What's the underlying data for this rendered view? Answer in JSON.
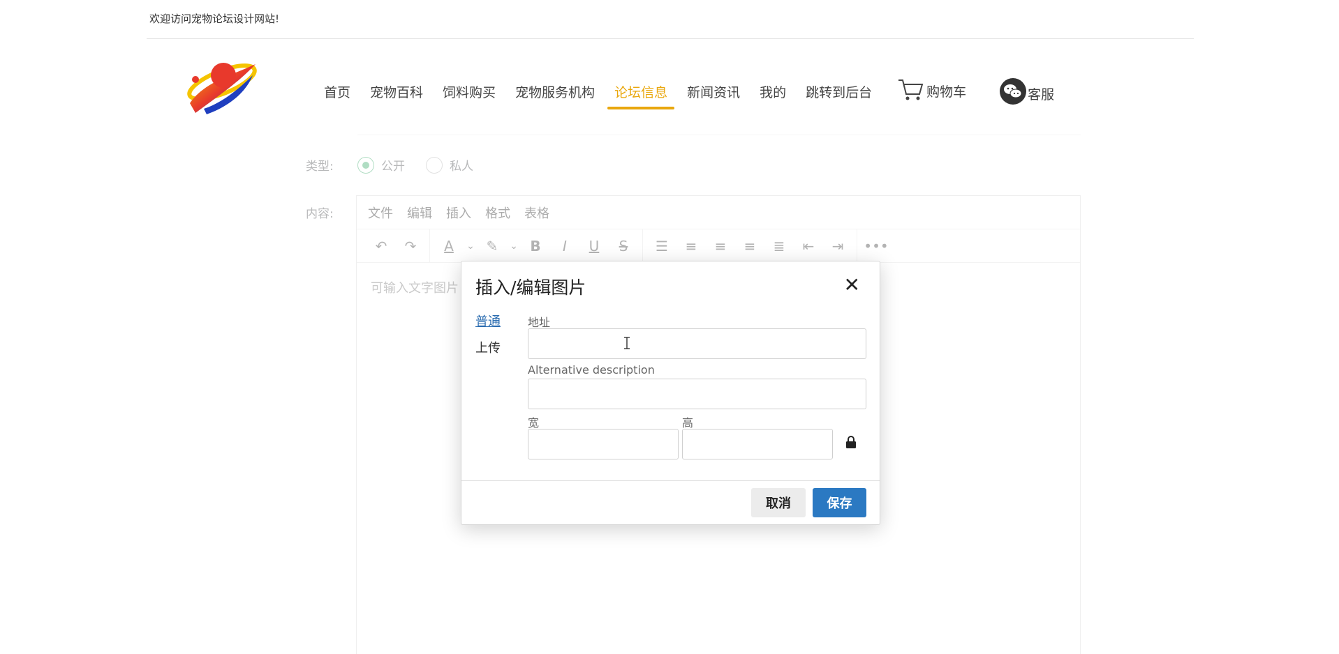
{
  "topbar": {
    "welcome": "欢迎访问宠物论坛设计网站!"
  },
  "nav": {
    "items": [
      {
        "label": "首页",
        "active": false
      },
      {
        "label": "宠物百科",
        "active": false
      },
      {
        "label": "饲料购买",
        "active": false
      },
      {
        "label": "宠物服务机构",
        "active": false
      },
      {
        "label": "论坛信息",
        "active": true
      },
      {
        "label": "新闻资讯",
        "active": false
      },
      {
        "label": "我的",
        "active": false
      },
      {
        "label": "跳转到后台",
        "active": false
      }
    ],
    "cart": "购物车",
    "service": "客服"
  },
  "form": {
    "type_label": "类型:",
    "type_options": [
      {
        "label": "公开",
        "checked": true
      },
      {
        "label": "私人",
        "checked": false
      }
    ],
    "content_label": "内容:",
    "editor_menu": [
      "文件",
      "编辑",
      "插入",
      "格式",
      "表格"
    ],
    "editor_placeholder": "可输入文字图片"
  },
  "modal": {
    "title": "插入/编辑图片",
    "tabs": [
      {
        "label": "普通",
        "active": true
      },
      {
        "label": "上传",
        "active": false
      }
    ],
    "address_label": "地址",
    "address_value": "",
    "alt_label": "Alternative description",
    "alt_value": "",
    "width_label": "宽",
    "width_value": "",
    "height_label": "高",
    "height_value": "",
    "cancel": "取消",
    "save": "保存"
  },
  "colors": {
    "active_nav": "#e9a70d",
    "primary_button": "#2b79c2",
    "tab_link": "#2b6cb0",
    "radio_checked": "#4fb37a"
  }
}
